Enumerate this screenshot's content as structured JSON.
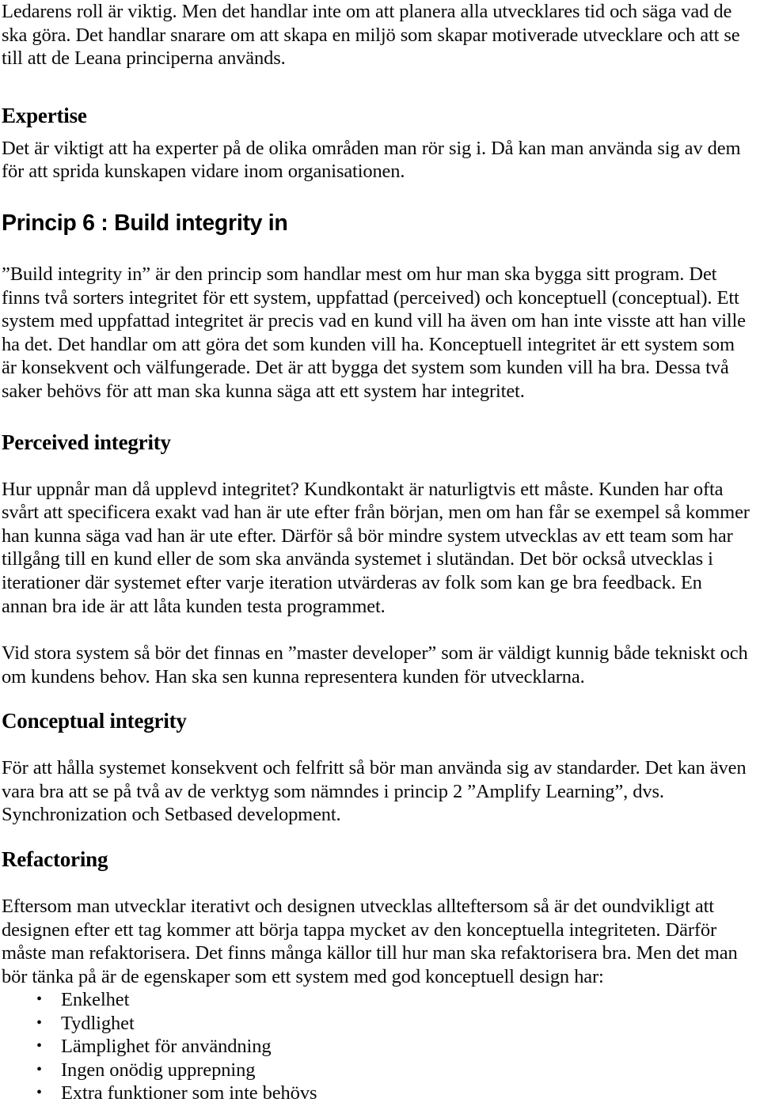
{
  "document": {
    "language": "sv",
    "page_title": "Princip 6 : Build integrity in",
    "bullet_glyph": "•"
  },
  "intro_paragraph": {
    "text": "Ledarens roll är viktig. Men det handlar inte om att planera alla utvecklares tid och säga vad de ska göra. Det handlar snarare om att skapa en miljö som skapar motiverade utvecklare och att se till att de Leana principerna används."
  },
  "sections": [
    {
      "id": "expertise",
      "heading": "Expertise",
      "heading_style": "serif-bold",
      "paragraphs": [
        "Det är viktigt att ha experter på de olika områden man rör sig i. Då kan man använda sig av dem för att sprida kunskapen vidare inom organisationen."
      ]
    },
    {
      "id": "princip-6",
      "heading": "Princip 6 : Build integrity in",
      "heading_style": "sans-bold",
      "paragraphs": [
        "”Build integrity in” är den princip som handlar mest om hur man ska bygga sitt program. Det finns två sorters integritet för ett system, uppfattad (perceived) och konceptuell (conceptual). Ett system med uppfattad integritet är precis vad en kund vill ha även om han inte visste att han ville ha det. Det handlar om att göra det som kunden vill ha. Konceptuell integritet är ett system som är konsekvent och välfungerade. Det är att bygga det system som kunden vill ha bra. Dessa två saker behövs för att man ska kunna säga att ett system har integritet."
      ]
    },
    {
      "id": "perceived-integrity",
      "heading": "Perceived integrity",
      "heading_style": "serif-bold",
      "paragraphs": [
        "Hur uppnår man då upplevd integritet? Kundkontakt är naturligtvis ett måste. Kunden har ofta svårt att specificera exakt vad han är ute efter från början, men om han får se exempel så kommer han kunna säga vad han är ute efter. Därför så bör mindre system utvecklas av ett team som har tillgång till en kund eller de som ska använda systemet i slutändan. Det bör också utvecklas i iterationer där systemet efter varje iteration utvärderas av folk som kan ge bra feedback. En annan bra ide är att låta kunden testa programmet.",
        "Vid stora system så bör det finnas en ”master developer” som är väldigt kunnig både tekniskt och om kundens behov. Han ska sen kunna representera kunden för utvecklarna."
      ]
    },
    {
      "id": "conceptual-integrity",
      "heading": "Conceptual integrity",
      "heading_style": "serif-bold",
      "paragraphs": [
        "För att hålla systemet konsekvent och felfritt så bör man använda sig av standarder. Det kan även vara bra att se på två av de verktyg som nämndes i princip 2 ”Amplify Learning”, dvs. Synchronization och Setbased development."
      ]
    },
    {
      "id": "refactoring",
      "heading": "Refactoring",
      "heading_style": "serif-bold",
      "paragraphs": [
        "Eftersom man utvecklar iterativt och designen utvecklas allteftersom så är det oundvikligt att designen efter ett tag kommer att börja tappa mycket av den konceptuella integriteten. Därför måste man refaktorisera. Det finns många källor till hur man ska refaktorisera bra. Men det man bör tänka på är de egenskaper som ett system med god konceptuell design har:"
      ],
      "bullets": [
        "Enkelhet",
        "Tydlighet",
        "Lämplighet för användning",
        "Ingen onödig upprepning",
        "Extra funktioner som inte behövs"
      ]
    }
  ]
}
